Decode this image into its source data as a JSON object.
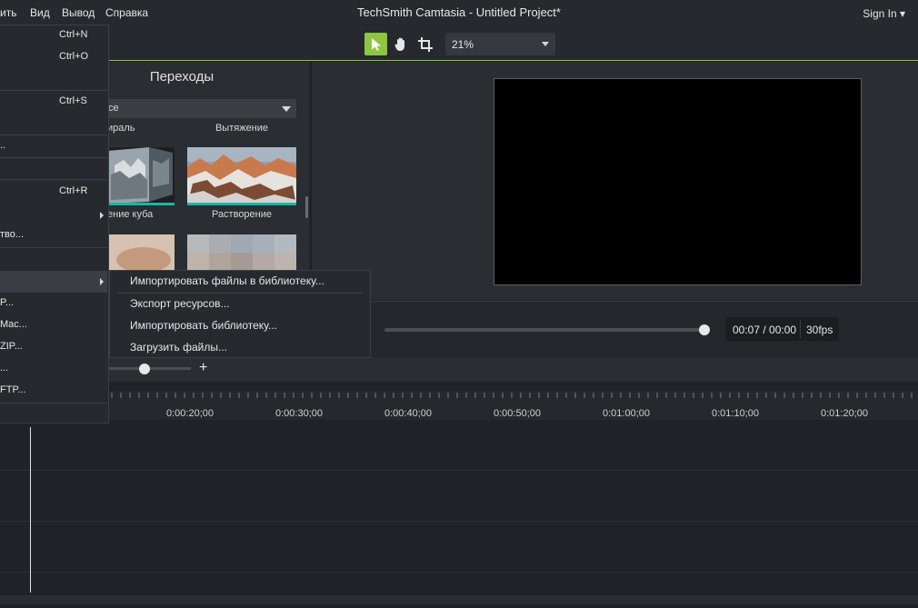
{
  "menubar": {
    "items": [
      "ить",
      "Вид",
      "Вывод",
      "Справка"
    ],
    "title": "TechSmith Camtasia - Untitled Project*",
    "sign_in": "Sign In ▾"
  },
  "toolbar": {
    "zoom_value": "21%"
  },
  "transitions_panel": {
    "title": "Переходы",
    "filter_value": "се",
    "captions": [
      "ираль",
      "Вытяжение",
      "ение куба",
      "Растворение"
    ]
  },
  "playback": {
    "time": "00:07 / 00:00",
    "fps": "30fps",
    "progress_fraction": 1.0
  },
  "timeline": {
    "ruler_labels": [
      "0:00:20;00",
      "0:00:30;00",
      "0:00:40;00",
      "0:00:50;00",
      "0:01:00;00",
      "0:01:10;00",
      "0:01:20;00"
    ],
    "zoom_plus": "+"
  },
  "file_menu": {
    "items": [
      {
        "label": "",
        "shortcut": "Ctrl+N"
      },
      {
        "label": "",
        "shortcut": "Ctrl+O"
      },
      {
        "label": "",
        "shortcut": "Ctrl+S"
      },
      {
        "label": "..",
        "shortcut": ""
      },
      {
        "label": "",
        "shortcut": "Ctrl+R"
      },
      {
        "label": "тво...",
        "shortcut": ""
      },
      {
        "label": "P...",
        "shortcut": ""
      },
      {
        "label": "Mac...",
        "shortcut": ""
      },
      {
        "label": "ZIP...",
        "shortcut": ""
      },
      {
        "label": "...",
        "shortcut": ""
      },
      {
        "label": "FTP...",
        "shortcut": ""
      }
    ]
  },
  "library_submenu": {
    "items": [
      "Импортировать файлы в библиотеку...",
      "Экспорт ресурсов...",
      "Импортировать библиотеку...",
      "Загрузить файлы..."
    ]
  },
  "colors": {
    "accent": "#8dc63f",
    "thumb_bar": "#18b7a6"
  }
}
